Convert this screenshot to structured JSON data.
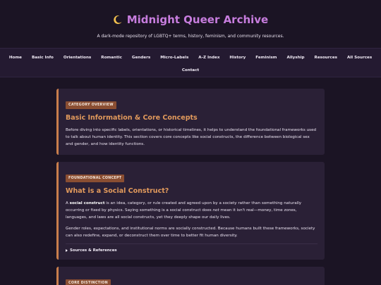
{
  "site": {
    "title": "Midnight Queer Archive",
    "logo_icon": "crescent-moon-icon",
    "tagline": "A dark-mode repository of LGBTQ+ terms, history, feminism, and community resources."
  },
  "nav": {
    "row1": [
      "Home",
      "Basic Info",
      "Orientations",
      "Romantic",
      "Genders",
      "Micro-Labels",
      "A-Z Index",
      "History",
      "Feminism",
      "Allyship",
      "Resources",
      "All Sources"
    ],
    "row2": [
      "Contact"
    ]
  },
  "colors": {
    "background": "#1b1424",
    "nav_background": "#241a31",
    "card_background": "#2a2036",
    "accent_orange": "#e29a5c",
    "badge_brown": "#8a4e32",
    "title_purple": "#c77dde"
  },
  "cards": [
    {
      "badge": "CATEGORY OVERVIEW",
      "title": "Basic Information & Core Concepts",
      "body": "Before diving into specific labels, orientations, or historical timelines, it helps to understand the foundational frameworks used to talk about human identity. This section covers core concepts like social constructs, the difference between biological sex and gender, and how identity functions."
    },
    {
      "badge": "FOUNDATIONAL CONCEPT",
      "title": "What is a Social Construct?",
      "p1_pre": "A ",
      "p1_strong": "social construct",
      "p1_mid": " is an idea, category, or rule created and agreed upon by a society rather than something naturally occurring or fixed by physics. Saying something is a social construct does ",
      "p1_em": "not",
      "p1_post": " mean it isn't real—money, time zones, languages, and laws are all social constructs, yet they deeply shape our daily lives.",
      "p2": "Gender roles, expectations, and institutional norms are socially constructed. Because humans built these frameworks, society can also redefine, expand, or deconstruct them over time to better fit human diversity.",
      "refs": "Sources & References"
    },
    {
      "badge": "CORE DISTINCTION"
    }
  ]
}
